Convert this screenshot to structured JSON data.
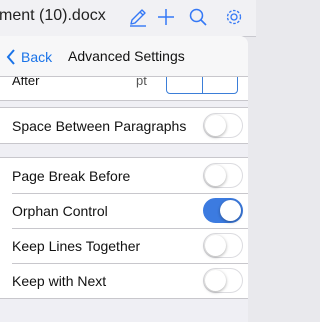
{
  "app": {
    "document_title": "ment (10).docx"
  },
  "toolbar": {
    "icons": [
      "pen-icon",
      "plus-icon",
      "search-icon",
      "gear-icon"
    ],
    "accent_color": "#3478f6"
  },
  "panel": {
    "back_label": "Back",
    "title": "Advanced Settings",
    "partial_row": {
      "label": "After",
      "value": "pt"
    },
    "sections": [
      {
        "rows": [
          {
            "label": "Space Between Paragraphs",
            "on": false
          }
        ]
      },
      {
        "rows": [
          {
            "label": "Page Break Before",
            "on": false
          },
          {
            "label": "Orphan Control",
            "on": true
          },
          {
            "label": "Keep Lines Together",
            "on": false
          },
          {
            "label": "Keep with Next",
            "on": false
          }
        ]
      }
    ]
  }
}
